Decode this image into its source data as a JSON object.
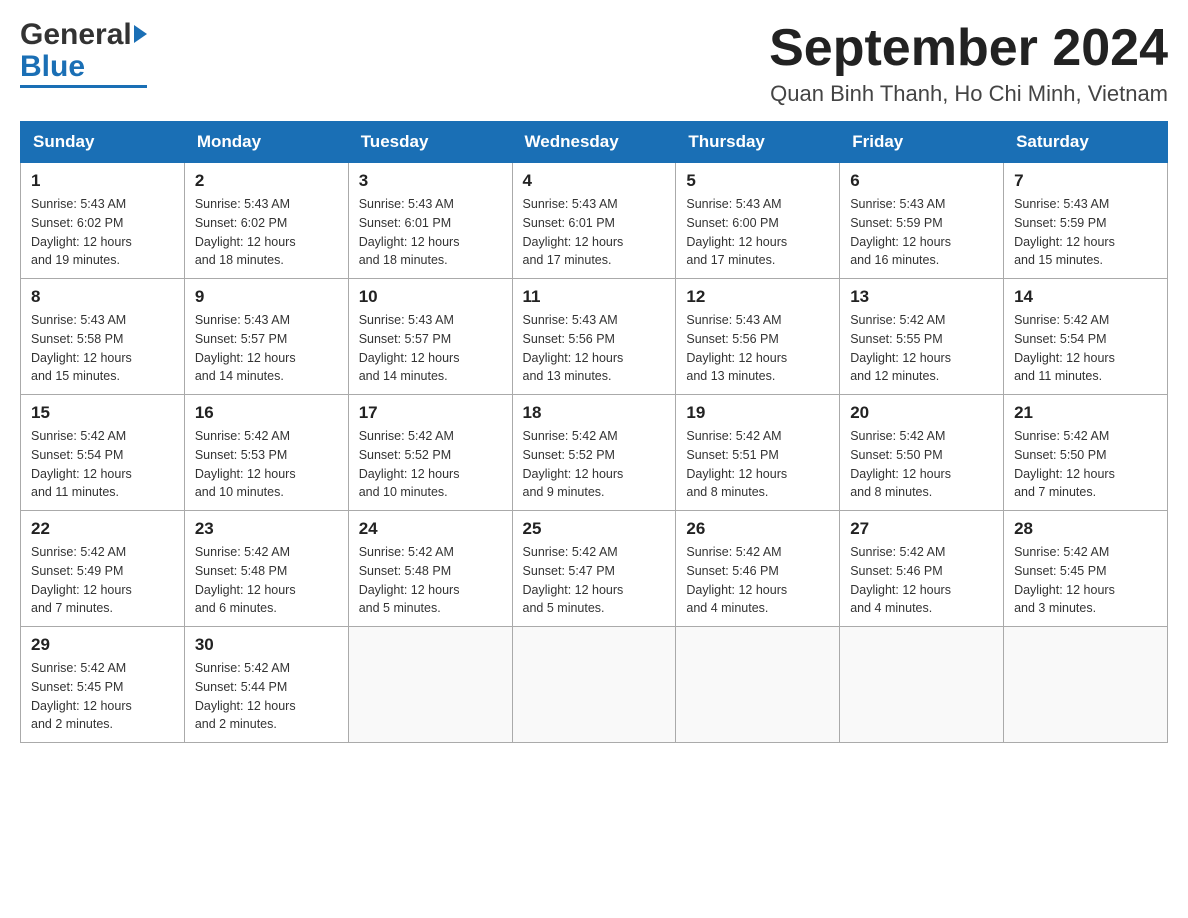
{
  "header": {
    "title": "September 2024",
    "subtitle": "Quan Binh Thanh, Ho Chi Minh, Vietnam",
    "logo_general": "General",
    "logo_blue": "Blue"
  },
  "columns": [
    "Sunday",
    "Monday",
    "Tuesday",
    "Wednesday",
    "Thursday",
    "Friday",
    "Saturday"
  ],
  "weeks": [
    [
      {
        "day": "1",
        "sunrise": "5:43 AM",
        "sunset": "6:02 PM",
        "daylight": "12 hours and 19 minutes."
      },
      {
        "day": "2",
        "sunrise": "5:43 AM",
        "sunset": "6:02 PM",
        "daylight": "12 hours and 18 minutes."
      },
      {
        "day": "3",
        "sunrise": "5:43 AM",
        "sunset": "6:01 PM",
        "daylight": "12 hours and 18 minutes."
      },
      {
        "day": "4",
        "sunrise": "5:43 AM",
        "sunset": "6:01 PM",
        "daylight": "12 hours and 17 minutes."
      },
      {
        "day": "5",
        "sunrise": "5:43 AM",
        "sunset": "6:00 PM",
        "daylight": "12 hours and 17 minutes."
      },
      {
        "day": "6",
        "sunrise": "5:43 AM",
        "sunset": "5:59 PM",
        "daylight": "12 hours and 16 minutes."
      },
      {
        "day": "7",
        "sunrise": "5:43 AM",
        "sunset": "5:59 PM",
        "daylight": "12 hours and 15 minutes."
      }
    ],
    [
      {
        "day": "8",
        "sunrise": "5:43 AM",
        "sunset": "5:58 PM",
        "daylight": "12 hours and 15 minutes."
      },
      {
        "day": "9",
        "sunrise": "5:43 AM",
        "sunset": "5:57 PM",
        "daylight": "12 hours and 14 minutes."
      },
      {
        "day": "10",
        "sunrise": "5:43 AM",
        "sunset": "5:57 PM",
        "daylight": "12 hours and 14 minutes."
      },
      {
        "day": "11",
        "sunrise": "5:43 AM",
        "sunset": "5:56 PM",
        "daylight": "12 hours and 13 minutes."
      },
      {
        "day": "12",
        "sunrise": "5:43 AM",
        "sunset": "5:56 PM",
        "daylight": "12 hours and 13 minutes."
      },
      {
        "day": "13",
        "sunrise": "5:42 AM",
        "sunset": "5:55 PM",
        "daylight": "12 hours and 12 minutes."
      },
      {
        "day": "14",
        "sunrise": "5:42 AM",
        "sunset": "5:54 PM",
        "daylight": "12 hours and 11 minutes."
      }
    ],
    [
      {
        "day": "15",
        "sunrise": "5:42 AM",
        "sunset": "5:54 PM",
        "daylight": "12 hours and 11 minutes."
      },
      {
        "day": "16",
        "sunrise": "5:42 AM",
        "sunset": "5:53 PM",
        "daylight": "12 hours and 10 minutes."
      },
      {
        "day": "17",
        "sunrise": "5:42 AM",
        "sunset": "5:52 PM",
        "daylight": "12 hours and 10 minutes."
      },
      {
        "day": "18",
        "sunrise": "5:42 AM",
        "sunset": "5:52 PM",
        "daylight": "12 hours and 9 minutes."
      },
      {
        "day": "19",
        "sunrise": "5:42 AM",
        "sunset": "5:51 PM",
        "daylight": "12 hours and 8 minutes."
      },
      {
        "day": "20",
        "sunrise": "5:42 AM",
        "sunset": "5:50 PM",
        "daylight": "12 hours and 8 minutes."
      },
      {
        "day": "21",
        "sunrise": "5:42 AM",
        "sunset": "5:50 PM",
        "daylight": "12 hours and 7 minutes."
      }
    ],
    [
      {
        "day": "22",
        "sunrise": "5:42 AM",
        "sunset": "5:49 PM",
        "daylight": "12 hours and 7 minutes."
      },
      {
        "day": "23",
        "sunrise": "5:42 AM",
        "sunset": "5:48 PM",
        "daylight": "12 hours and 6 minutes."
      },
      {
        "day": "24",
        "sunrise": "5:42 AM",
        "sunset": "5:48 PM",
        "daylight": "12 hours and 5 minutes."
      },
      {
        "day": "25",
        "sunrise": "5:42 AM",
        "sunset": "5:47 PM",
        "daylight": "12 hours and 5 minutes."
      },
      {
        "day": "26",
        "sunrise": "5:42 AM",
        "sunset": "5:46 PM",
        "daylight": "12 hours and 4 minutes."
      },
      {
        "day": "27",
        "sunrise": "5:42 AM",
        "sunset": "5:46 PM",
        "daylight": "12 hours and 4 minutes."
      },
      {
        "day": "28",
        "sunrise": "5:42 AM",
        "sunset": "5:45 PM",
        "daylight": "12 hours and 3 minutes."
      }
    ],
    [
      {
        "day": "29",
        "sunrise": "5:42 AM",
        "sunset": "5:45 PM",
        "daylight": "12 hours and 2 minutes."
      },
      {
        "day": "30",
        "sunrise": "5:42 AM",
        "sunset": "5:44 PM",
        "daylight": "12 hours and 2 minutes."
      },
      null,
      null,
      null,
      null,
      null
    ]
  ],
  "labels": {
    "sunrise": "Sunrise:",
    "sunset": "Sunset:",
    "daylight": "Daylight:"
  }
}
